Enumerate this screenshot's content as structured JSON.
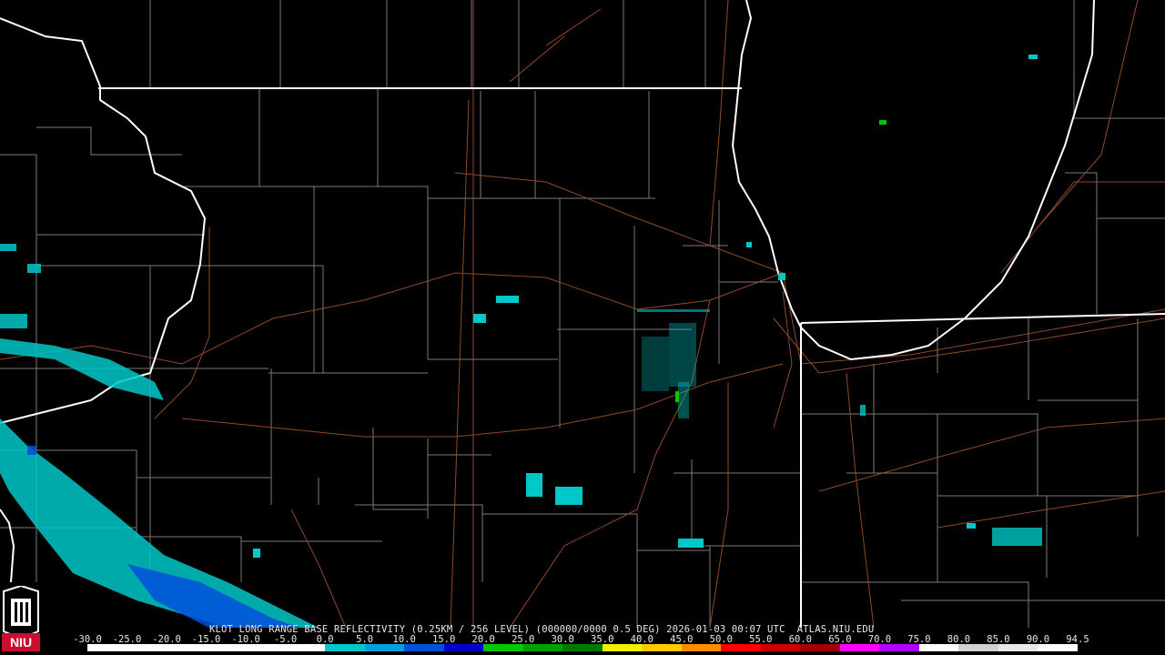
{
  "caption": "KLOT LONG RANGE BASE REFLECTIVITY (0.25KM / 256 LEVEL) (000000/0000 0.5 DEG) 2026-01-03 00:07 UTC  ATLAS.NIU.EDU",
  "scale": {
    "labels": [
      "-30.0",
      "-25.0",
      "-20.0",
      "-15.0",
      "-10.0",
      "-5.0",
      "0.0",
      "5.0",
      "10.0",
      "15.0",
      "20.0",
      "25.0",
      "30.0",
      "35.0",
      "40.0",
      "45.0",
      "50.0",
      "55.0",
      "60.0",
      "65.0",
      "70.0",
      "75.0",
      "80.0",
      "85.0",
      "90.0",
      "94.5"
    ],
    "colors": [
      "#000000",
      "#000000",
      "#000000",
      "#000000",
      "#000000",
      "#000000",
      "#00c8c8",
      "#00a0dc",
      "#0050dc",
      "#0000c8",
      "#00c800",
      "#00a000",
      "#007800",
      "#f0f000",
      "#ffc800",
      "#ff8c00",
      "#ff0000",
      "#c80000",
      "#a00000",
      "#ff00ff",
      "#b400ff",
      "#ffffff",
      "#d0d0d0",
      "#e8e8e8",
      "#ffffff"
    ]
  },
  "logo": {
    "text": "NIU",
    "brand_color": "#c8102e"
  }
}
